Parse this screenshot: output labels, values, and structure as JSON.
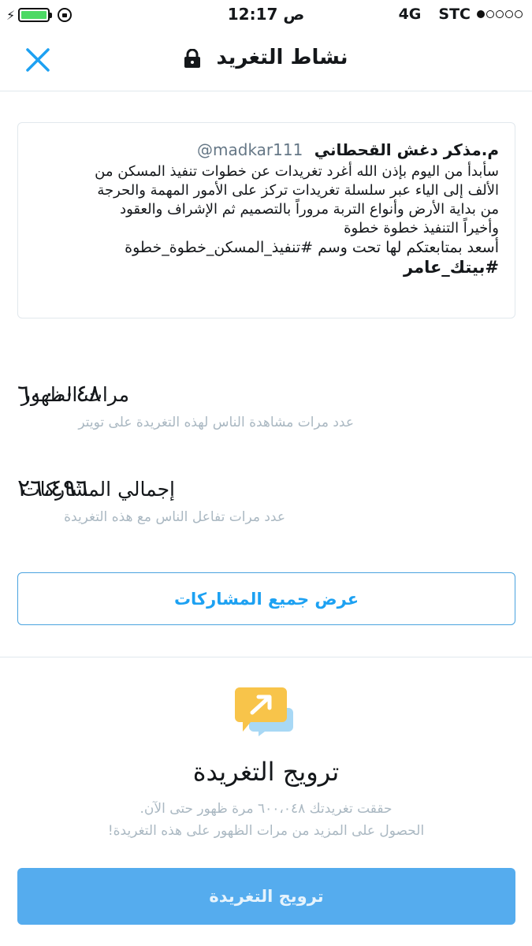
{
  "status_bar": {
    "time": "12:17 ص",
    "network": "4G",
    "carrier": "STC",
    "battery_level": 1.0,
    "signal_bars_filled": 1,
    "signal_bars_total": 5
  },
  "nav": {
    "title": "نشاط التغريد",
    "close_icon": "close-icon",
    "lock_icon": "lock-icon"
  },
  "tweet": {
    "author": "م.مذكر دغش القحطاني",
    "handle": "@madkar111",
    "lines": [
      "سأبدأ من اليوم بإذن الله أغرد تغريدات عن خطوات تنفيذ المسكن من",
      "الألف إلى الياء عبر سلسلة تغريدات تركز على الأمور المهمة والحرجة",
      "من بداية الأرض وأنواع التربة مروراً بالتصميم ثم الإشراف والعقود",
      "وأخيراً التنفيذ خطوة خطوة",
      "أسعد بمتابعتكم لها تحت وسم #تنفيذ_المسكن_خطوة_خطوة",
      "#بيتك_عامر"
    ]
  },
  "stats": {
    "impressions": {
      "label": "مرات الظهور",
      "description": "عدد مرات مشاهدة الناس لهذه التغريدة على تويتر",
      "value": "٦٠٠،٠٤٨"
    },
    "engagements": {
      "label": "إجمالي المشاركات",
      "description": "عدد مرات تفاعل الناس مع هذه التغريدة",
      "value": "٢٦،٤٩٦"
    }
  },
  "view_all_button": "عرض جميع المشاركات",
  "promo": {
    "icon": "promote-icon",
    "title": "ترويج التغريدة",
    "line1": "حققت تغريدتك ٦٠٠،٠٤٨ مرة ظهور حتى الآن.",
    "line2": "الحصول على المزيد من مرات الظهور على هذه التغريدة!",
    "button": "ترويج التغريدة"
  },
  "colors": {
    "accent": "#1da1f2",
    "promote_button": "#55acee",
    "battery": "#4cd964",
    "muted_text": "#aab8c2",
    "border": "#e1e8ed"
  }
}
